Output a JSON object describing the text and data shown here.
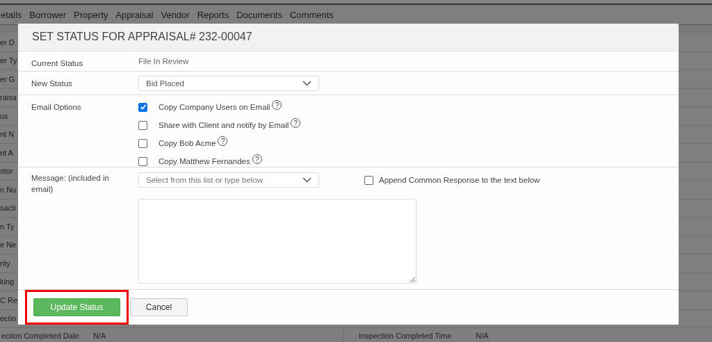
{
  "nav_tabs": [
    "etails",
    "Borrower",
    "Property",
    "Appraisal",
    "Vendor",
    "Reports",
    "Documents",
    "Comments"
  ],
  "background_labels": [
    "er D",
    "er Ty",
    "er G",
    "raisa",
    "us",
    "nt N",
    "nt A",
    "stor",
    "n Nu",
    "sacti",
    "n Ty",
    "e Ne",
    "rity",
    "king",
    "C Re",
    "ectio"
  ],
  "background_footer": [
    {
      "label": "ection Completed Date",
      "value": "N/A"
    },
    {
      "label": "Inspection Completed Time",
      "value": "N/A"
    }
  ],
  "dialog": {
    "title": "SET STATUS FOR APPRAISAL# 232-00047",
    "fields": [
      {
        "kind": "text",
        "label": "Current Status",
        "value": "File In Review"
      },
      {
        "kind": "select",
        "label": "New Status",
        "value": "Bid Placed"
      },
      {
        "kind": "checkboxes",
        "label": "Email Options",
        "options": [
          {
            "label": "Copy Company Users on Email",
            "checked": true,
            "help": "?"
          },
          {
            "label": "Share with Client and notify by Email",
            "checked": false,
            "help": "?"
          },
          {
            "label": "Copy Bob Acme",
            "checked": false,
            "help": "?"
          },
          {
            "label": "Copy Matthew Fernandes",
            "checked": false,
            "help": "?"
          }
        ]
      },
      {
        "kind": "message",
        "label": "Message: (included in email)",
        "placeholder": "Select from this list or type below",
        "append": {
          "label": "Append Common Response to the text below",
          "checked": false
        }
      }
    ],
    "buttons": [
      {
        "label": "Update Status",
        "kind": "primary",
        "highlighted": true
      },
      {
        "label": "Cancel",
        "kind": "default",
        "highlighted": false
      }
    ]
  }
}
